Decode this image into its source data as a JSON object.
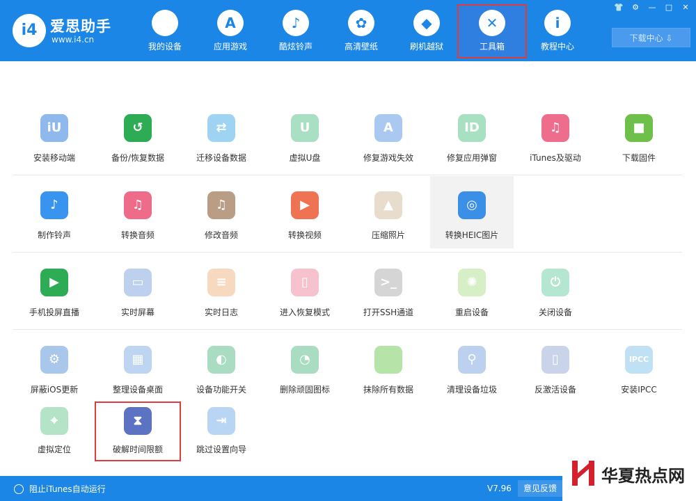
{
  "header": {
    "logo_mark": "i4",
    "app_name": "爱思助手",
    "url": "www.i4.cn",
    "nav": [
      {
        "label": "我的设备",
        "icon": "apple-icon",
        "glyph": ""
      },
      {
        "label": "应用游戏",
        "icon": "app-store-icon",
        "glyph": "A"
      },
      {
        "label": "酷炫铃声",
        "icon": "bell-icon",
        "glyph": "♪"
      },
      {
        "label": "高清壁纸",
        "icon": "flower-icon",
        "glyph": "✿"
      },
      {
        "label": "刷机越狱",
        "icon": "dropbox-icon",
        "glyph": "◆"
      },
      {
        "label": "工具箱",
        "icon": "tools-icon",
        "glyph": "✕"
      },
      {
        "label": "教程中心",
        "icon": "info-icon",
        "glyph": "i"
      }
    ],
    "active_nav": "工具箱",
    "window_controls": [
      "👕",
      "⚙",
      "—",
      "□",
      "✕"
    ],
    "download_label": "下载中心 ⇩"
  },
  "tools": {
    "row1": [
      {
        "label": "安装移动端",
        "icon": "i4-logo-icon",
        "color": "#8fb8ec",
        "glyph": "iU"
      },
      {
        "label": "备份/恢复数据",
        "icon": "clock-restore-icon",
        "color": "#2eab55",
        "glyph": "↺"
      },
      {
        "label": "迁移设备数据",
        "icon": "transfer-phones-icon",
        "color": "#9fd3f2",
        "glyph": "⇄"
      },
      {
        "label": "虚拟U盘",
        "icon": "usb-drive-icon",
        "color": "#a9e0c4",
        "glyph": "U"
      },
      {
        "label": "修复游戏失效",
        "icon": "app-store-repair-icon",
        "color": "#a9c9f0",
        "glyph": "A"
      },
      {
        "label": "修复应用弹窗",
        "icon": "apple-id-icon",
        "color": "#a8e0c2",
        "glyph": "ID"
      },
      {
        "label": "iTunes及驱动",
        "icon": "itunes-icon",
        "color": "#ef6d8c",
        "glyph": "♫"
      },
      {
        "label": "下载固件",
        "icon": "cube-icon",
        "color": "#6ec04a",
        "glyph": "■"
      }
    ],
    "row2": [
      {
        "label": "制作铃声",
        "icon": "bell-plus-icon",
        "color": "#3894ee",
        "glyph": "♪"
      },
      {
        "label": "转换音频",
        "icon": "music-note-icon",
        "color": "#ee6c8a",
        "glyph": "♫"
      },
      {
        "label": "修改音频",
        "icon": "music-edit-icon",
        "color": "#b99d84",
        "glyph": "♫"
      },
      {
        "label": "转换视频",
        "icon": "play-video-icon",
        "color": "#ef7253",
        "glyph": "▶"
      },
      {
        "label": "压缩照片",
        "icon": "photo-icon",
        "color": "#e8dccd",
        "glyph": "▲"
      },
      {
        "label": "转换HEIC图片",
        "icon": "image-convert-icon",
        "color": "#3c8fe6",
        "glyph": "◎"
      }
    ],
    "row3": [
      {
        "label": "手机投屏直播",
        "icon": "screen-cast-icon",
        "color": "#2eab55",
        "glyph": "▶"
      },
      {
        "label": "实时屏幕",
        "icon": "monitor-icon",
        "color": "#bdd1ee",
        "glyph": "▭"
      },
      {
        "label": "实时日志",
        "icon": "log-document-icon",
        "color": "#f6d9bf",
        "glyph": "≡"
      },
      {
        "label": "进入恢复模式",
        "icon": "phone-recovery-icon",
        "color": "#f6c2cd",
        "glyph": "▯"
      },
      {
        "label": "打开SSH通道",
        "icon": "terminal-icon",
        "color": "#d5d5d5",
        "glyph": ">_"
      },
      {
        "label": "重启设备",
        "icon": "restart-icon",
        "color": "#d6efc6",
        "glyph": "✺"
      },
      {
        "label": "关闭设备",
        "icon": "power-icon",
        "color": "#b5e6d1",
        "glyph": "⏻"
      }
    ],
    "row4": [
      {
        "label": "屏蔽iOS更新",
        "icon": "block-update-icon",
        "color": "#a8c7ea",
        "glyph": "⚙"
      },
      {
        "label": "整理设备桌面",
        "icon": "grid-apps-icon",
        "color": "#bdd5f0",
        "glyph": "▦"
      },
      {
        "label": "设备功能开关",
        "icon": "toggle-switch-icon",
        "color": "#a9dcc0",
        "glyph": "◐"
      },
      {
        "label": "删除顽固图标",
        "icon": "pie-icon",
        "color": "#a9dcc0",
        "glyph": "◔"
      },
      {
        "label": "抹除所有数据",
        "icon": "apple-erase-icon",
        "color": "#b5e3a8",
        "glyph": ""
      },
      {
        "label": "清理设备垃圾",
        "icon": "broom-icon",
        "color": "#bcd0ef",
        "glyph": "⚲"
      },
      {
        "label": "反激活设备",
        "icon": "deactivate-phone-icon",
        "color": "#c9d3ea",
        "glyph": "▯"
      },
      {
        "label": "安装IPCC",
        "icon": "ipcc-icon",
        "color": "#bfe1f3",
        "glyph": "IPCC"
      }
    ],
    "row5": [
      {
        "label": "虚拟定位",
        "icon": "location-pin-icon",
        "color": "#b5e3c8",
        "glyph": "⌖"
      },
      {
        "label": "破解时间限额",
        "icon": "hourglass-icon",
        "color": "#5b73c2",
        "glyph": "⧗"
      },
      {
        "label": "跳过设置向导",
        "icon": "skip-wizard-icon",
        "color": "#b8d6f3",
        "glyph": "⇥"
      }
    ],
    "highlighted_tool": "破解时间限额",
    "hover_tool": "转换HEIC图片"
  },
  "footer": {
    "itunes_toggle_label": "阻止iTunes自动运行",
    "version": "V7.96",
    "feedback_label": "意见反馈"
  },
  "watermark": {
    "text": "华夏热点网"
  }
}
